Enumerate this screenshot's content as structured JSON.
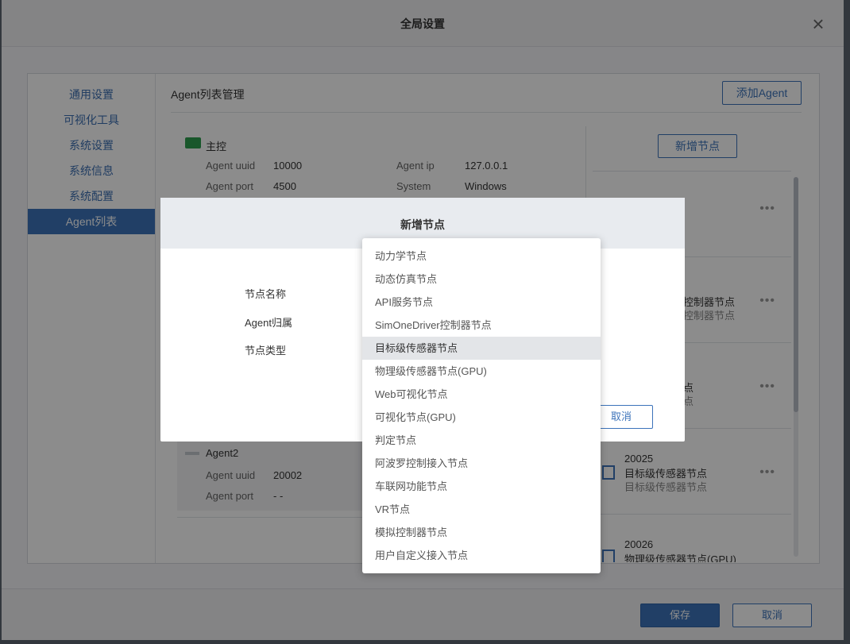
{
  "window": {
    "title": "全局设置",
    "close_icon": "close-icon"
  },
  "sidebar": {
    "items": [
      {
        "label": "通用设置"
      },
      {
        "label": "可视化工具"
      },
      {
        "label": "系统设置"
      },
      {
        "label": "系统信息"
      },
      {
        "label": "系统配置"
      },
      {
        "label": "Agent列表"
      }
    ],
    "active_index": 5
  },
  "content": {
    "title": "Agent列表管理",
    "add_agent_label": "添加Agent",
    "new_node_label": "新增节点",
    "master": {
      "name": "主控",
      "uuid_label": "Agent uuid",
      "uuid": "10000",
      "ip_label": "Agent ip",
      "ip": "127.0.0.1",
      "port_label": "Agent port",
      "port": "4500",
      "system_label": "System",
      "system": "Windows"
    },
    "agent2": {
      "name": "Agent2",
      "uuid_label": "Agent uuid",
      "uuid": "20002",
      "port_label": "Agent port",
      "port": "- -"
    },
    "nodes": [
      {
        "id": "20025",
        "title": "目标级传感器节点",
        "subtitle": "目标级传感器节点"
      },
      {
        "id": "20026",
        "title": "物理级传感器节点(GPU)"
      }
    ],
    "partial_texts": [
      "控制器节点",
      "控制器节点",
      "点",
      "点"
    ]
  },
  "footer": {
    "save_label": "保存",
    "cancel_label": "取消"
  },
  "modal": {
    "title": "新增节点",
    "fields": [
      {
        "label": "节点名称"
      },
      {
        "label": "Agent归属"
      },
      {
        "label": "节点类型"
      }
    ],
    "cancel_label": "取消"
  },
  "dropdown": {
    "options": [
      "动力学节点",
      "动态仿真节点",
      "API服务节点",
      "SimOneDriver控制器节点",
      "目标级传感器节点",
      "物理级传感器节点(GPU)",
      "Web可视化节点",
      "可视化节点(GPU)",
      "判定节点",
      "阿波罗控制接入节点",
      "车联网功能节点",
      "VR节点",
      "模拟控制器节点",
      "用户自定义接入节点"
    ],
    "highlighted_index": 4
  },
  "colors": {
    "accent": "#3c73ba",
    "agent_icon": "#2e9e4f"
  }
}
